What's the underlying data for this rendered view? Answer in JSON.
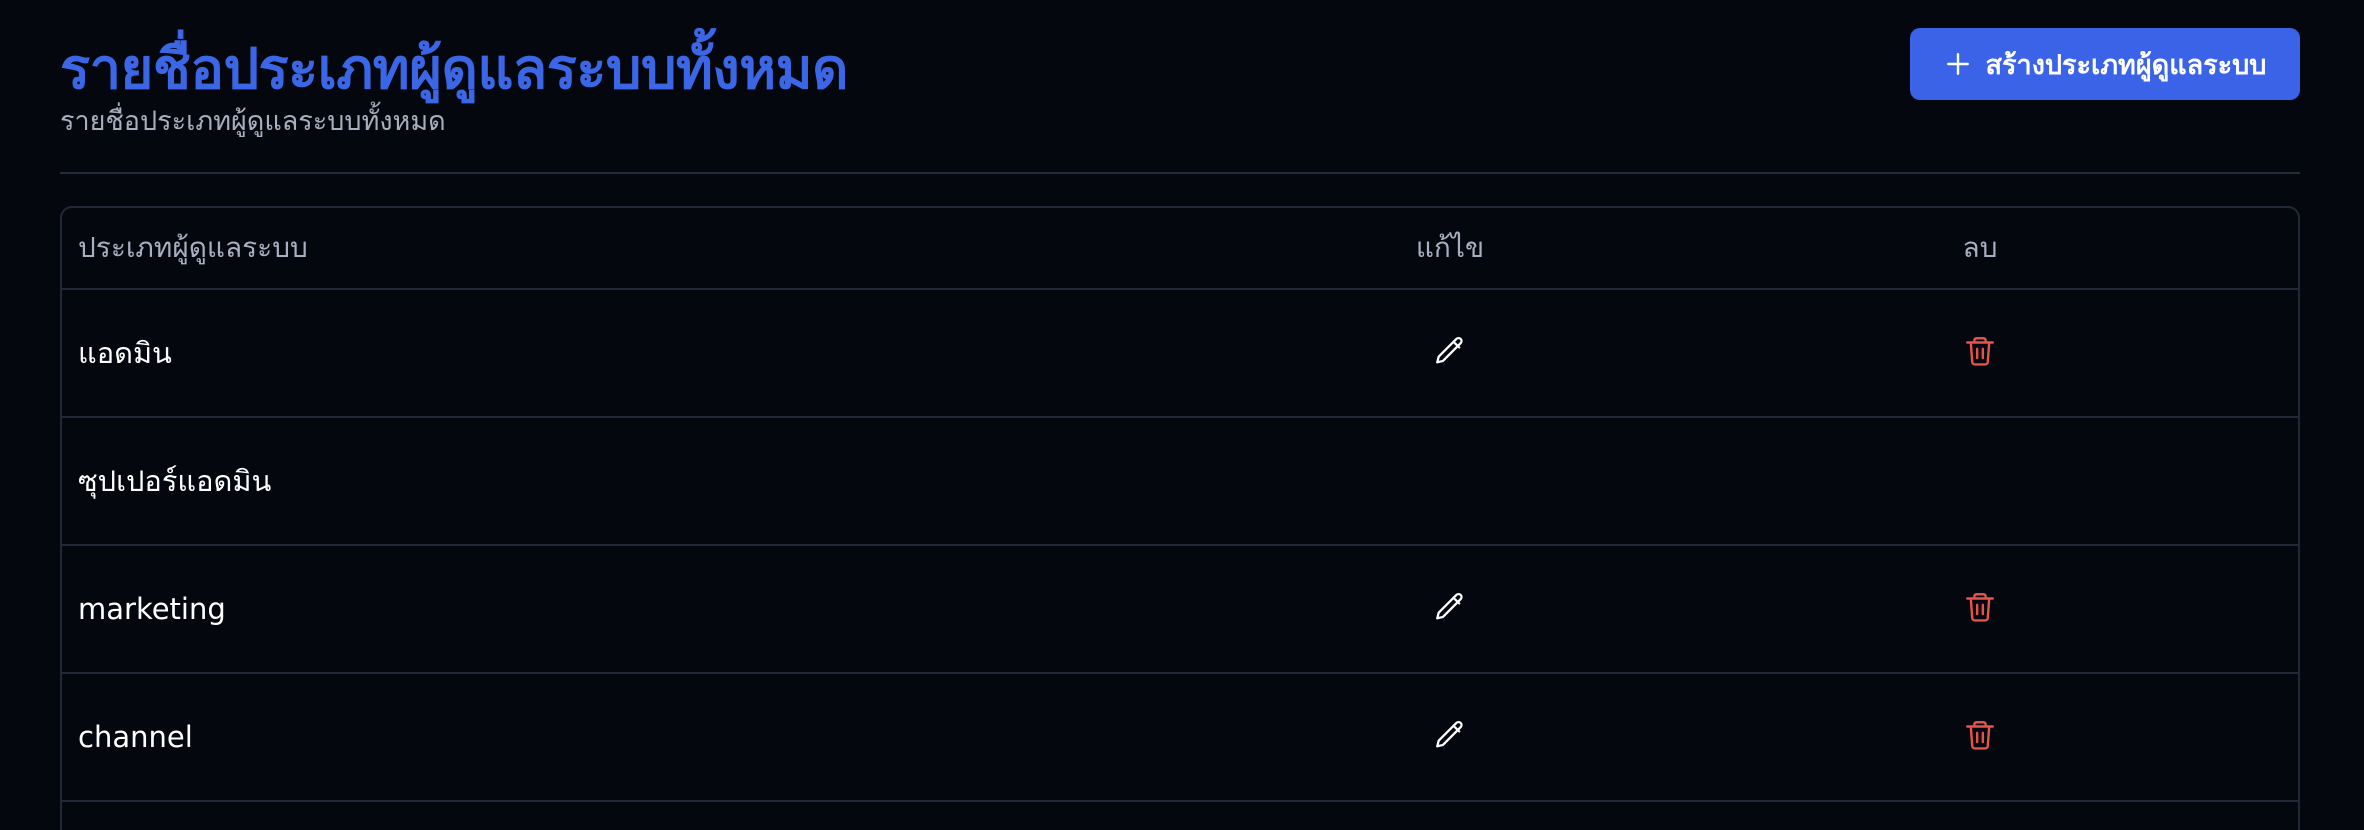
{
  "header": {
    "title": "รายชื่อประเภทผู้ดูแลระบบทั้งหมด",
    "subtitle": "รายชื่อประเภทผู้ดูแลระบบทั้งหมด",
    "create_button_label": "สร้างประเภทผู้ดูแลระบบ",
    "create_button_icon": "plus-icon"
  },
  "colors": {
    "background": "#05070f",
    "accent": "#3b63e8",
    "title": "#3b67e6",
    "delete": "#e5534b",
    "border": "#232838"
  },
  "table": {
    "columns": [
      "ประเภทผู้ดูแลระบบ",
      "แก้ไข",
      "ลบ"
    ],
    "rows": [
      {
        "name": "แอดมิน",
        "editable": true,
        "deletable": true,
        "edit_icon": "pencil-icon",
        "delete_icon": "trash-icon"
      },
      {
        "name": "ซุปเปอร์แอดมิน",
        "editable": false,
        "deletable": false
      },
      {
        "name": "marketing",
        "editable": true,
        "deletable": true,
        "edit_icon": "pencil-icon",
        "delete_icon": "trash-icon"
      },
      {
        "name": "channel",
        "editable": true,
        "deletable": true,
        "edit_icon": "pencil-icon",
        "delete_icon": "trash-icon"
      }
    ]
  }
}
